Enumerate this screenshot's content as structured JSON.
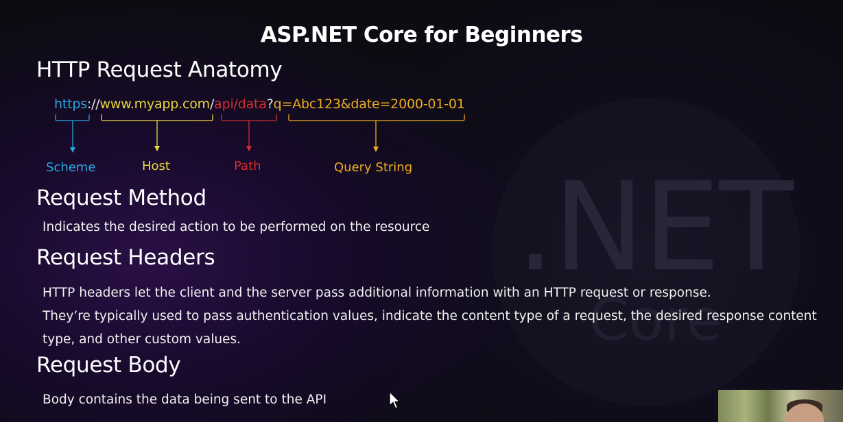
{
  "slide": {
    "title": "ASP.NET Core for Beginners",
    "background_text": {
      "logo": ".NET",
      "sub": "Core"
    }
  },
  "anatomy": {
    "heading": "HTTP Request Anatomy",
    "url": {
      "scheme": "https",
      "sep1": "://",
      "host": "www.myapp.com",
      "sep2": "/",
      "path": "api/data",
      "sep3": "?",
      "query": "q=Abc123&date=2000-01-01"
    },
    "labels": {
      "scheme": "Scheme",
      "host": "Host",
      "path": "Path",
      "query": "Query String"
    },
    "colors": {
      "scheme": "#2aa6e0",
      "host": "#e8d840",
      "path": "#d32f2f",
      "query": "#f0ac20"
    }
  },
  "sections": {
    "method": {
      "heading": "Request Method",
      "text": "Indicates the desired action to be performed on the resource"
    },
    "headers": {
      "heading": "Request Headers",
      "line1": "HTTP headers let the client and the server pass additional information with an HTTP request or response.",
      "line2": "They’re typically used to pass authentication values, indicate the content type of a request, the desired response content",
      "line3": "type, and other custom values."
    },
    "body": {
      "heading": "Request Body",
      "text": "Body contains the data being sent to the API"
    }
  }
}
